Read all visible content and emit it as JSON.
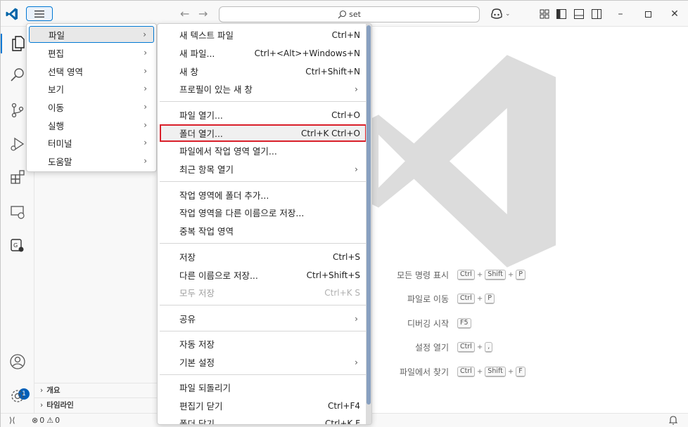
{
  "titlebar": {
    "search_text": "set"
  },
  "activity_badge": "1",
  "menubar": [
    {
      "label": "파일"
    },
    {
      "label": "편집"
    },
    {
      "label": "선택 영역"
    },
    {
      "label": "보기"
    },
    {
      "label": "이동"
    },
    {
      "label": "실행"
    },
    {
      "label": "터미널"
    },
    {
      "label": "도움말"
    }
  ],
  "file_menu": {
    "items": [
      {
        "label": "새 텍스트 파일",
        "shortcut": "Ctrl+N"
      },
      {
        "label": "새 파일...",
        "shortcut": "Ctrl+<Alt>+Windows+N"
      },
      {
        "label": "새 창",
        "shortcut": "Ctrl+Shift+N"
      },
      {
        "label": "프로필이 있는 새 창",
        "shortcut": ""
      },
      {
        "label": "파일 열기...",
        "shortcut": "Ctrl+O"
      },
      {
        "label": "폴더 열기...",
        "shortcut": "Ctrl+K Ctrl+O"
      },
      {
        "label": "파일에서 작업 영역 열기...",
        "shortcut": ""
      },
      {
        "label": "최근 항목 열기",
        "shortcut": ""
      },
      {
        "label": "작업 영역에 폴더 추가...",
        "shortcut": ""
      },
      {
        "label": "작업 영역을 다른 이름으로 저장...",
        "shortcut": ""
      },
      {
        "label": "중복 작업 영역",
        "shortcut": ""
      },
      {
        "label": "저장",
        "shortcut": "Ctrl+S"
      },
      {
        "label": "다른 이름으로 저장...",
        "shortcut": "Ctrl+Shift+S"
      },
      {
        "label": "모두 저장",
        "shortcut": "Ctrl+K S"
      },
      {
        "label": "공유",
        "shortcut": ""
      },
      {
        "label": "자동 저장",
        "shortcut": ""
      },
      {
        "label": "기본 설정",
        "shortcut": ""
      },
      {
        "label": "파일 되돌리기",
        "shortcut": ""
      },
      {
        "label": "편집기 닫기",
        "shortcut": "Ctrl+F4"
      },
      {
        "label": "폴더 닫기",
        "shortcut": "Ctrl+K F"
      }
    ]
  },
  "sidebar": {
    "outline": "개요",
    "timeline": "타임라인"
  },
  "shortcuts": [
    {
      "label": "모든 명령 표시",
      "keys": [
        "Ctrl",
        "Shift",
        "P"
      ]
    },
    {
      "label": "파일로 이동",
      "keys": [
        "Ctrl",
        "P"
      ]
    },
    {
      "label": "디버깅 시작",
      "keys": [
        "F5"
      ]
    },
    {
      "label": "설정 열기",
      "keys": [
        "Ctrl",
        ","
      ]
    },
    {
      "label": "파일에서 찾기",
      "keys": [
        "Ctrl",
        "Shift",
        "F"
      ]
    }
  ],
  "statusbar": {
    "errors": "0",
    "warnings": "0"
  }
}
